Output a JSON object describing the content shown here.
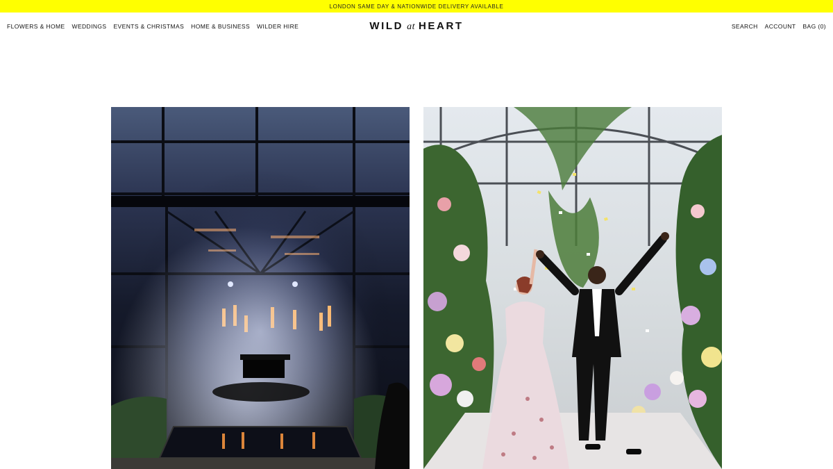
{
  "announcement": "LONDON SAME DAY & NATIONWIDE DELIVERY AVAILABLE",
  "nav_left": [
    {
      "label": "FLOWERS & HOME"
    },
    {
      "label": "WEDDINGS"
    },
    {
      "label": "EVENTS & CHRISTMAS"
    },
    {
      "label": "HOME & BUSINESS"
    },
    {
      "label": "WILDER HIRE"
    }
  ],
  "logo": {
    "word1": "WILD",
    "word2": "at",
    "word3": "HEART"
  },
  "nav_right": {
    "search": "SEARCH",
    "account": "ACCOUNT",
    "bag": "BAG (0)"
  },
  "colors": {
    "announcement_bg": "#ffff00",
    "page_bg": "#ffffff",
    "text": "#111111"
  },
  "gallery": [
    {
      "image": "glasshouse-event-with-grand-piano-photo"
    },
    {
      "image": "wedding-couple-floral-arch-photo"
    }
  ]
}
